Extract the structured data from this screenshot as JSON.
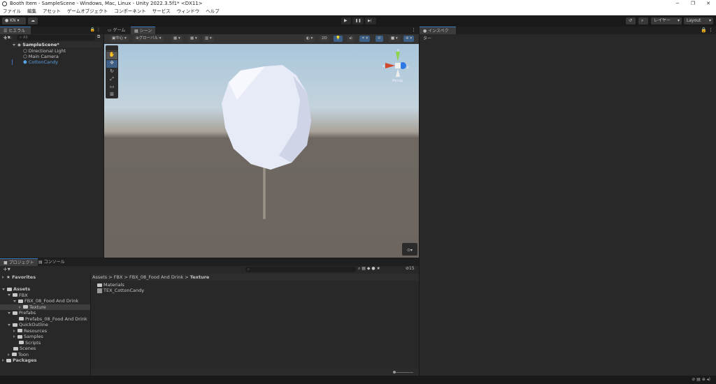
{
  "window": {
    "title": "Booth Item - SampleScene - Windows, Mac, Linux - Unity 2022.3.5f1* <DX11>",
    "controls": [
      "─",
      "❐",
      "✕"
    ]
  },
  "menu": [
    "ファイル",
    "編集",
    "アセット",
    "ゲームオブジェクト",
    "コンポーネント",
    "サービス",
    "ウィンドウ",
    "ヘルプ"
  ],
  "toolbar": {
    "account": "KN",
    "play": "▶",
    "pause": "❚❚",
    "step": "▶|",
    "layers": "レイヤー",
    "layout": "Layout"
  },
  "hierarchy": {
    "tab": "ヒエラルキー",
    "search_placeholder": "All",
    "scene": "SampleScene*",
    "items": [
      "Directional Light",
      "Main Camera",
      "CottonCandy"
    ]
  },
  "scene": {
    "tabs": [
      "ゲーム",
      "シーン"
    ],
    "pivot": "中心",
    "space": "グローバル",
    "mode2d": "2D",
    "gizmo_label": "Persp",
    "axis_x": "x",
    "axis_y": "y",
    "axis_z": "z"
  },
  "inspector": {
    "tab": "インスペクター"
  },
  "project": {
    "tabs": [
      "プロジェクト",
      "コンソール"
    ],
    "favorites": "Favorites",
    "hidden_count": "15",
    "tree": [
      {
        "label": "Assets",
        "level": 0,
        "bold": true
      },
      {
        "label": "FBX",
        "level": 1
      },
      {
        "label": "FBX_08_Food And Drink",
        "level": 2
      },
      {
        "label": "Texture",
        "level": 3,
        "selected": true
      },
      {
        "label": "Prefabs",
        "level": 1
      },
      {
        "label": "Prefabs_08_Food And Drink",
        "level": 2
      },
      {
        "label": "QuickOutline",
        "level": 1
      },
      {
        "label": "Resources",
        "level": 2
      },
      {
        "label": "Samples",
        "level": 2
      },
      {
        "label": "Scripts",
        "level": 2
      },
      {
        "label": "Scenes",
        "level": 1
      },
      {
        "label": "Toon",
        "level": 1
      },
      {
        "label": "Packages",
        "level": 0,
        "bold": true
      }
    ],
    "breadcrumb": [
      "Assets",
      "FBX",
      "FBX_08_Food And Drink",
      "Texture"
    ],
    "files": [
      "Materials",
      "TEX_CottonCandy"
    ]
  }
}
